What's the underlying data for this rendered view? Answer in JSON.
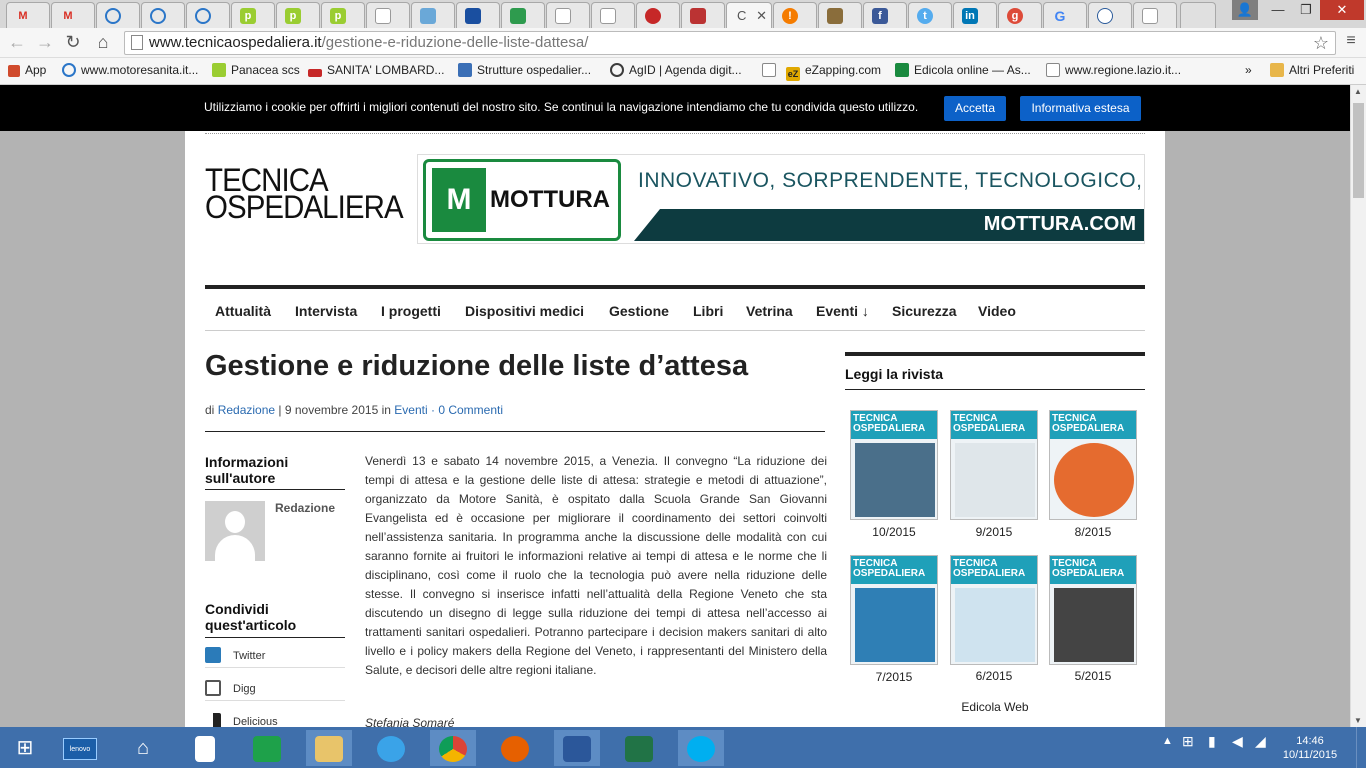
{
  "browser": {
    "url_domain": "www.tecnicaospedaliera.it",
    "url_path": "/gestione-e-riduzione-delle-liste-dattesa/",
    "active_tab_label": "C",
    "bookmarks": [
      {
        "label": "App",
        "color": "#d04a2c"
      },
      {
        "label": "www.motoresanita.it...",
        "color": "#2b76c8"
      },
      {
        "label": "Panacea scs",
        "color": "#9acd32"
      },
      {
        "label": "SANITA' LOMBARD...",
        "color": "#c62828"
      },
      {
        "label": "Strutture ospedalier...",
        "color": "#3b6fb6"
      },
      {
        "label": "AgID | Agenda digit...",
        "color": "#3c3c3c"
      },
      {
        "label": "",
        "color": "#ffffff"
      },
      {
        "label": "eZapping.com",
        "color": "#e0a800"
      },
      {
        "label": "Edicola online — As...",
        "color": "#1a8a3f"
      },
      {
        "label": "www.regione.lazio.it...",
        "color": "#ffffff"
      },
      {
        "label": "»",
        "color": ""
      },
      {
        "label": "Altri Preferiti",
        "color": "#e8b64a"
      }
    ]
  },
  "cookie_bar": {
    "message": "Utilizziamo i cookie per offrirti i migliori contenuti del nostro sito. Se continui la navigazione intendiamo che tu condivida questo utilizzo.",
    "accept_label": "Accetta",
    "info_label": "Informativa estesa"
  },
  "site": {
    "logo_line1": "TECNICA",
    "logo_line2": "OSPEDALIERA"
  },
  "ad": {
    "brand": "MOTTURA",
    "tagline": "INNOVATIVO, SORPRENDENTE, TECNOLOGICO,",
    "site": "MOTTURA.COM"
  },
  "nav": [
    "Attualità",
    "Intervista",
    "I progetti",
    "Dispositivi medici",
    "Gestione",
    "Libri",
    "Vetrina",
    "Eventi ↓",
    "Sicurezza",
    "Video"
  ],
  "article": {
    "title": "Gestione e riduzione delle liste d’attesa",
    "meta_by": "di",
    "meta_author": "Redazione",
    "meta_date": "| 9 novembre 2015 in",
    "meta_category": "Eventi",
    "meta_comments": "· 0 Commenti",
    "body": "Venerdì 13 e sabato 14 novembre 2015, a Venezia. Il convegno “La riduzione dei tempi di attesa e la gestione delle liste di attesa: strategie e metodi di attuazione”, organizzato da Motore Sanità, è ospitato dalla Scuola Grande San Giovanni Evangelista ed è occasione per migliorare il coordinamento dei settori coinvolti nell’assistenza sanitaria. In programma anche la discussione delle modalità con cui saranno fornite ai fruitori le informazioni relative ai tempi di attesa e le norme che li disciplinano, così come il ruolo che la tecnologia può avere nella riduzione delle stesse. Il convegno si inserisce infatti nell’attualità della Regione Veneto che sta discutendo un disegno di legge sulla riduzione dei tempi di attesa nell’accesso ai trattamenti sanitari ospedalieri. Potranno partecipare i decision makers sanitari di alto livello e i policy makers della Regione del Veneto, i rappresentanti del Ministero della Salute, e decisori delle altre regioni italiane.",
    "signature": "Stefania Somaré"
  },
  "author_box": {
    "heading": "Informazioni sull'autore",
    "name": "Redazione"
  },
  "share_box": {
    "heading": "Condividi quest'articolo",
    "items": [
      {
        "label": "Twitter",
        "color": "#2b7bb9"
      },
      {
        "label": "Digg",
        "color": "#555555"
      },
      {
        "label": "Delicious",
        "color": "#222222"
      }
    ]
  },
  "sidebar": {
    "title": "Leggi la rivista",
    "masthead": "TECNICA OSPEDALIERA",
    "issues": [
      {
        "label": "10/2015",
        "art": "#4a6f8a"
      },
      {
        "label": "9/2015",
        "art": "#dfe6ea"
      },
      {
        "label": "8/2015",
        "art": "#e56b2f"
      },
      {
        "label": "7/2015",
        "art": "#2f7fb5"
      },
      {
        "label": "6/2015",
        "art": "#cfe3ef"
      },
      {
        "label": "5/2015",
        "art": "#444444"
      }
    ],
    "footer_link": "Edicola Web"
  },
  "taskbar": {
    "time": "14:46",
    "date": "10/11/2015",
    "lenovo": "lenovo"
  }
}
